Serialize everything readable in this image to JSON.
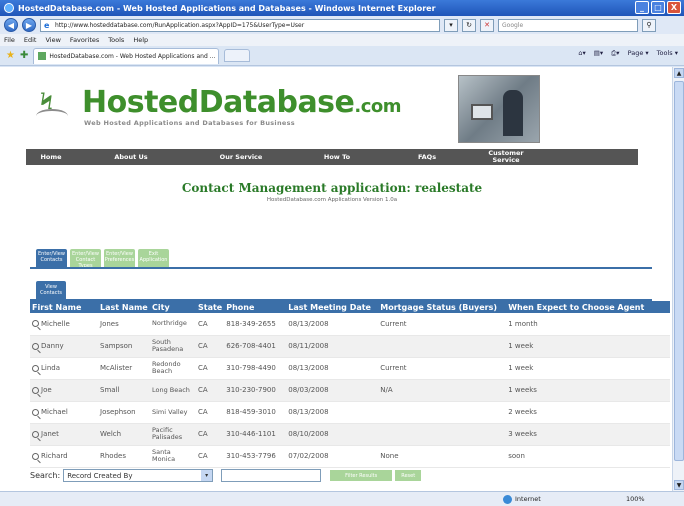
{
  "window": {
    "title": "HostedDatabase.com - Web Hosted Applications and Databases - Windows Internet Explorer",
    "url": "http://www.hosteddatabase.com/RunApplication.aspx?AppID=175&UserType=User",
    "search_placeholder": "Google",
    "controls": {
      "minimize": "_",
      "maximize": "□",
      "close": "X"
    }
  },
  "menu": [
    "File",
    "Edit",
    "View",
    "Favorites",
    "Tools",
    "Help"
  ],
  "tab": {
    "title": "HostedDatabase.com - Web Hosted Applications and ..."
  },
  "command_bar": [
    "Page ▾",
    "Tools ▾"
  ],
  "header": {
    "brand": "HostedDatabase",
    "brand_suffix": ".com",
    "tagline": "Web Hosted Applications and Databases for Business"
  },
  "nav": [
    "Home",
    "About Us",
    "Our Service",
    "How To",
    "FAQs",
    "Customer Service"
  ],
  "app": {
    "title": "Contact Management application: realestate",
    "subtitle": "HostedDatabase.com Applications Version 1.0a"
  },
  "subtabs": [
    "Enter/View Contacts",
    "Enter/View Contact Types",
    "Enter/View Preferences",
    "Exit Application"
  ],
  "view_tab": "View Contacts",
  "table": {
    "columns": [
      "First Name",
      "Last Name",
      "City",
      "State",
      "Phone",
      "Last Meeting Date",
      "Mortgage Status (Buyers)",
      "When Expect to Choose Agent"
    ],
    "rows": [
      [
        "Michelle",
        "Jones",
        "Northridge",
        "CA",
        "818-349-2655",
        "08/13/2008",
        "Current",
        "1 month"
      ],
      [
        "Danny",
        "Sampson",
        "South Pasadena",
        "CA",
        "626-708-4401",
        "08/11/2008",
        "",
        "1 week"
      ],
      [
        "Linda",
        "McAlister",
        "Redondo Beach",
        "CA",
        "310-798-4490",
        "08/13/2008",
        "Current",
        "1 week"
      ],
      [
        "Joe",
        "Small",
        "Long Beach",
        "CA",
        "310-230-7900",
        "08/03/2008",
        "N/A",
        "1 weeks"
      ],
      [
        "Michael",
        "Josephson",
        "Simi Valley",
        "CA",
        "818-459-3010",
        "08/13/2008",
        "",
        "2 weeks"
      ],
      [
        "Janet",
        "Welch",
        "Pacific Palisades",
        "CA",
        "310-446-1101",
        "08/10/2008",
        "",
        "3 weeks"
      ],
      [
        "Richard",
        "Rhodes",
        "Santa Monica",
        "CA",
        "310-453-7796",
        "07/02/2008",
        "None",
        "soon"
      ]
    ]
  },
  "search": {
    "label": "Search:",
    "field": "Record Created By",
    "value": "",
    "filter_button": "Filter Results",
    "reset_button": "Reset"
  },
  "status": {
    "zone": "Internet",
    "zoom": "100%"
  },
  "colors": {
    "brand_green": "#3e8f2c",
    "tab_blue": "#3b6fa8",
    "tab_green": "#a9d59a",
    "nav_gray": "#555555"
  }
}
